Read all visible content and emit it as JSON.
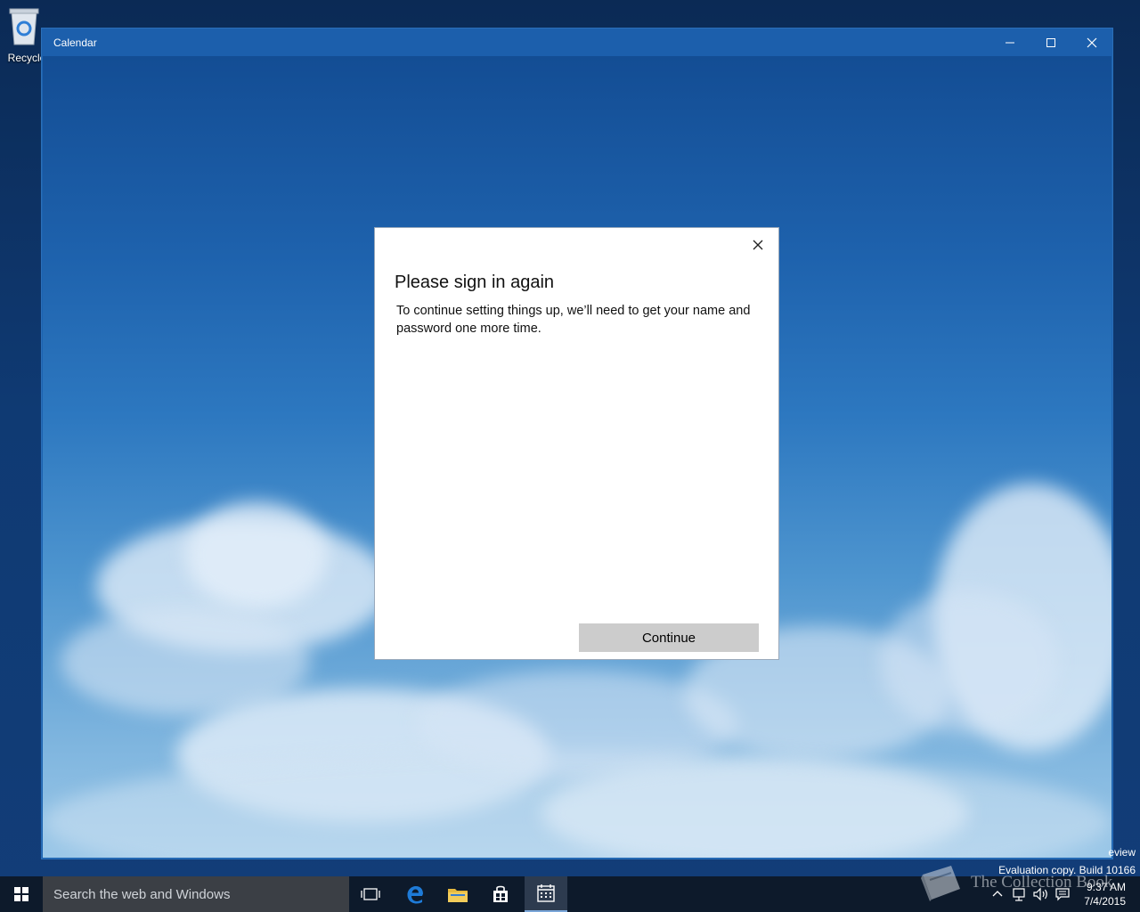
{
  "desktop": {
    "recycle_label": "Recycle"
  },
  "window": {
    "title": "Calendar",
    "controls": [
      "minimize-icon",
      "maximize-icon",
      "close-icon"
    ]
  },
  "dialog": {
    "title": "Please sign in again",
    "body": "To continue setting things up, we’ll need to get your name and password one more time.",
    "continue_label": "Continue"
  },
  "watermark": {
    "preview_fragment": "eview",
    "build": "Evaluation copy. Build 10166",
    "brand": "The Collection Book"
  },
  "taskbar": {
    "search_placeholder": "Search the web and Windows",
    "apps": [
      "task-view-icon",
      "edge-icon",
      "file-explorer-icon",
      "store-icon",
      "calendar-icon"
    ],
    "clock_time": "9:37 AM",
    "clock_date": "7/4/2015"
  },
  "colors": {
    "titlebar": "#1c5fac",
    "taskbar": "#0d1a2b",
    "button": "#cccccc"
  }
}
